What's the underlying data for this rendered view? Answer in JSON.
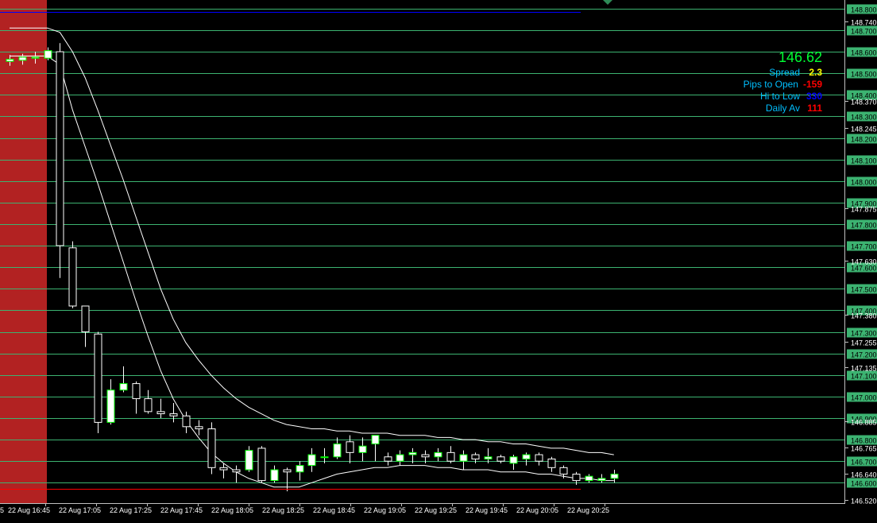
{
  "colors": {
    "background": "#000000",
    "grid": "#3cb371",
    "bull_candle": "#ffffff",
    "bear_candle": "#000000",
    "candle_outline": "#00ff00",
    "envelope": "#ffffff",
    "session_shade": "#b22222",
    "ask_line": "#ff0000",
    "high_line": "#0000ff",
    "axis_label_bg": "#3cb371",
    "axis_text": "#ffffff",
    "marker": "#2e8b57"
  },
  "marker_icon": "triangle-down-icon",
  "price_axis": {
    "min": 146.52,
    "max": 148.84,
    "boxed_labels": [
      "148.800",
      "148.700",
      "148.600",
      "148.500",
      "148.400",
      "148.300",
      "148.200",
      "148.100",
      "148.000",
      "147.900",
      "147.800",
      "147.700",
      "147.600",
      "147.500",
      "147.400",
      "147.300",
      "147.200",
      "147.100",
      "147.000",
      "146.900",
      "146.800",
      "146.700",
      "146.600"
    ],
    "plain_labels": [
      "148.740",
      "148.370",
      "148.245",
      "147.875",
      "147.630",
      "147.380",
      "147.255",
      "147.135",
      "146.885",
      "146.765",
      "146.640",
      "146.520"
    ]
  },
  "time_axis": {
    "labels": [
      "22 Aug 16:45",
      "22 Aug 17:05",
      "22 Aug 17:25",
      "22 Aug 17:45",
      "22 Aug 18:05",
      "22 Aug 18:25",
      "22 Aug 18:45",
      "22 Aug 19:05",
      "22 Aug 19:25",
      "22 Aug 19:45",
      "22 Aug 20:05",
      "22 Aug 20:25"
    ],
    "leading_fragment": "5"
  },
  "info_panel": {
    "price": "146.62",
    "rows": [
      {
        "label": "Spread",
        "value": "2.3",
        "color": "#ffff00"
      },
      {
        "label": "Pips to Open",
        "value": "-159",
        "color": "#ff0000"
      },
      {
        "label": "Hi to Low",
        "value": "330",
        "color": "#0000ff"
      },
      {
        "label": "Daily Av",
        "value": "111",
        "color": "#ff0000"
      }
    ]
  },
  "levels": {
    "ask_line_price": 146.57,
    "day_high_price": 148.785
  },
  "chart_data": {
    "type": "candlestick",
    "title": "",
    "xlabel": "",
    "ylabel": "",
    "ylim": [
      146.52,
      148.84
    ],
    "grid": true,
    "candles": [
      {
        "o": 148.555,
        "h": 148.585,
        "l": 148.535,
        "c": 148.565
      },
      {
        "o": 148.56,
        "h": 148.59,
        "l": 148.54,
        "c": 148.575
      },
      {
        "o": 148.57,
        "h": 148.6,
        "l": 148.545,
        "c": 148.575
      },
      {
        "o": 148.57,
        "h": 148.62,
        "l": 148.56,
        "c": 148.605
      },
      {
        "o": 148.6,
        "h": 148.64,
        "l": 147.55,
        "c": 147.7
      },
      {
        "o": 147.69,
        "h": 147.72,
        "l": 147.41,
        "c": 147.42
      },
      {
        "o": 147.42,
        "h": 147.42,
        "l": 147.23,
        "c": 147.3
      },
      {
        "o": 147.29,
        "h": 147.3,
        "l": 146.83,
        "c": 146.88
      },
      {
        "o": 146.88,
        "h": 147.08,
        "l": 146.87,
        "c": 147.03
      },
      {
        "o": 147.03,
        "h": 147.14,
        "l": 147.02,
        "c": 147.06
      },
      {
        "o": 147.06,
        "h": 147.07,
        "l": 146.92,
        "c": 146.99
      },
      {
        "o": 146.99,
        "h": 147.03,
        "l": 146.92,
        "c": 146.93
      },
      {
        "o": 146.93,
        "h": 146.99,
        "l": 146.9,
        "c": 146.92
      },
      {
        "o": 146.92,
        "h": 146.97,
        "l": 146.88,
        "c": 146.91
      },
      {
        "o": 146.91,
        "h": 146.93,
        "l": 146.83,
        "c": 146.86
      },
      {
        "o": 146.86,
        "h": 146.89,
        "l": 146.82,
        "c": 146.85
      },
      {
        "o": 146.85,
        "h": 146.88,
        "l": 146.64,
        "c": 146.67
      },
      {
        "o": 146.67,
        "h": 146.69,
        "l": 146.62,
        "c": 146.66
      },
      {
        "o": 146.66,
        "h": 146.68,
        "l": 146.6,
        "c": 146.65
      },
      {
        "o": 146.66,
        "h": 146.77,
        "l": 146.65,
        "c": 146.75
      },
      {
        "o": 146.76,
        "h": 146.77,
        "l": 146.6,
        "c": 146.61
      },
      {
        "o": 146.61,
        "h": 146.68,
        "l": 146.6,
        "c": 146.66
      },
      {
        "o": 146.66,
        "h": 146.67,
        "l": 146.56,
        "c": 146.65
      },
      {
        "o": 146.65,
        "h": 146.7,
        "l": 146.61,
        "c": 146.68
      },
      {
        "o": 146.68,
        "h": 146.76,
        "l": 146.65,
        "c": 146.73
      },
      {
        "o": 146.72,
        "h": 146.76,
        "l": 146.69,
        "c": 146.72
      },
      {
        "o": 146.72,
        "h": 146.81,
        "l": 146.71,
        "c": 146.78
      },
      {
        "o": 146.79,
        "h": 146.82,
        "l": 146.69,
        "c": 146.74
      },
      {
        "o": 146.74,
        "h": 146.81,
        "l": 146.7,
        "c": 146.77
      },
      {
        "o": 146.78,
        "h": 146.82,
        "l": 146.7,
        "c": 146.82
      },
      {
        "o": 146.72,
        "h": 146.74,
        "l": 146.68,
        "c": 146.7
      },
      {
        "o": 146.7,
        "h": 146.75,
        "l": 146.68,
        "c": 146.73
      },
      {
        "o": 146.73,
        "h": 146.76,
        "l": 146.69,
        "c": 146.74
      },
      {
        "o": 146.73,
        "h": 146.75,
        "l": 146.69,
        "c": 146.72
      },
      {
        "o": 146.72,
        "h": 146.76,
        "l": 146.7,
        "c": 146.74
      },
      {
        "o": 146.74,
        "h": 146.77,
        "l": 146.69,
        "c": 146.7
      },
      {
        "o": 146.7,
        "h": 146.75,
        "l": 146.66,
        "c": 146.73
      },
      {
        "o": 146.73,
        "h": 146.74,
        "l": 146.69,
        "c": 146.71
      },
      {
        "o": 146.71,
        "h": 146.76,
        "l": 146.69,
        "c": 146.72
      },
      {
        "o": 146.72,
        "h": 146.73,
        "l": 146.69,
        "c": 146.7
      },
      {
        "o": 146.69,
        "h": 146.73,
        "l": 146.66,
        "c": 146.72
      },
      {
        "o": 146.71,
        "h": 146.74,
        "l": 146.68,
        "c": 146.73
      },
      {
        "o": 146.73,
        "h": 146.74,
        "l": 146.68,
        "c": 146.7
      },
      {
        "o": 146.71,
        "h": 146.72,
        "l": 146.65,
        "c": 146.67
      },
      {
        "o": 146.67,
        "h": 146.68,
        "l": 146.62,
        "c": 146.64
      },
      {
        "o": 146.64,
        "h": 146.65,
        "l": 146.59,
        "c": 146.61
      },
      {
        "o": 146.61,
        "h": 146.64,
        "l": 146.6,
        "c": 146.63
      },
      {
        "o": 146.61,
        "h": 146.64,
        "l": 146.6,
        "c": 146.62
      },
      {
        "o": 146.62,
        "h": 146.66,
        "l": 146.6,
        "c": 146.64
      }
    ],
    "envelope_upper": [
      148.71,
      148.71,
      148.71,
      148.71,
      148.69,
      148.6,
      148.48,
      148.33,
      148.17,
      148.01,
      147.84,
      147.67,
      147.5,
      147.36,
      147.25,
      147.17,
      147.1,
      147.04,
      146.99,
      146.95,
      146.92,
      146.89,
      146.87,
      146.86,
      146.85,
      146.85,
      146.84,
      146.84,
      146.83,
      146.83,
      146.83,
      146.82,
      146.82,
      146.82,
      146.81,
      146.81,
      146.8,
      146.8,
      146.79,
      146.79,
      146.78,
      146.78,
      146.77,
      146.76,
      146.76,
      146.75,
      146.74,
      146.74,
      146.73
    ],
    "envelope_lower": [
      148.58,
      148.58,
      148.58,
      148.58,
      148.54,
      148.33,
      148.16,
      147.99,
      147.81,
      147.63,
      147.45,
      147.28,
      147.12,
      146.99,
      146.89,
      146.81,
      146.74,
      146.69,
      146.65,
      146.62,
      146.6,
      146.58,
      146.58,
      146.58,
      146.6,
      146.62,
      146.64,
      146.65,
      146.66,
      146.67,
      146.67,
      146.68,
      146.68,
      146.68,
      146.67,
      146.67,
      146.66,
      146.66,
      146.66,
      146.65,
      146.65,
      146.65,
      146.64,
      146.64,
      146.63,
      146.62,
      146.62,
      146.61,
      146.61
    ]
  }
}
